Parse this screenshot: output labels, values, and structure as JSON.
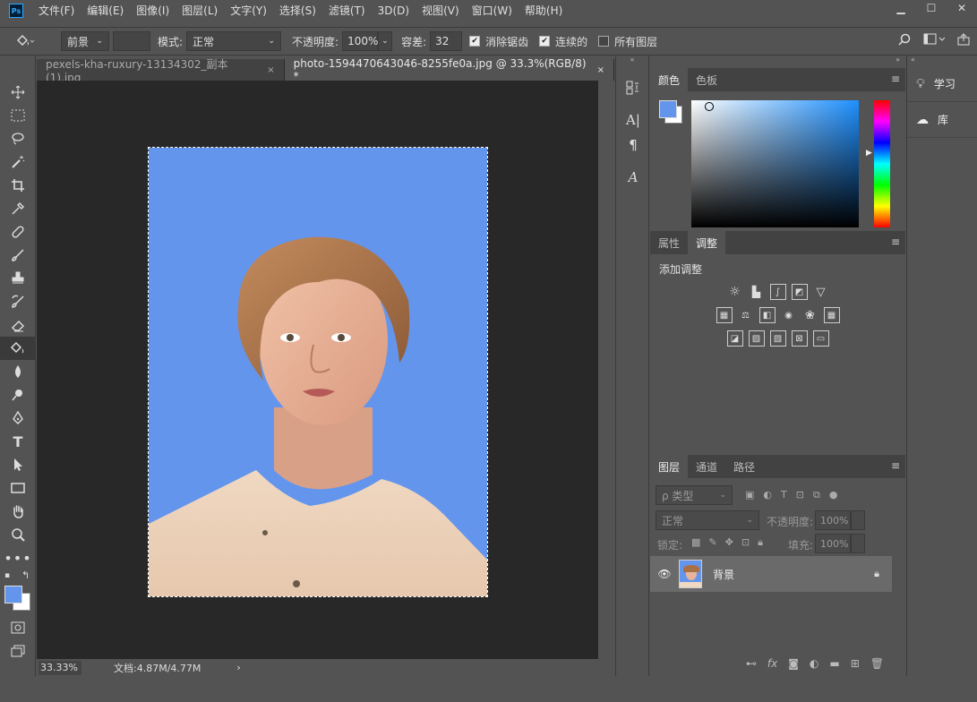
{
  "menu": {
    "items": [
      "文件(F)",
      "编辑(E)",
      "图像(I)",
      "图层(L)",
      "文字(Y)",
      "选择(S)",
      "滤镜(T)",
      "3D(D)",
      "视图(V)",
      "窗口(W)",
      "帮助(H)"
    ]
  },
  "window": {
    "minimize": "▁",
    "maximize": "☐",
    "close": "✕"
  },
  "options": {
    "fill_source": "前景",
    "mode_label": "模式:",
    "mode_value": "正常",
    "opacity_label": "不透明度:",
    "opacity_value": "100%",
    "tolerance_label": "容差:",
    "tolerance_value": "32",
    "antialias_label": "消除锯齿",
    "contiguous_label": "连续的",
    "all_layers_label": "所有图层"
  },
  "tabs": [
    {
      "label": "pexels-kha-ruxury-13134302_副本(1).jpg",
      "close": "×"
    },
    {
      "label": "photo-1594470643046-8255fe0a.jpg @ 33.3%(RGB/8) *",
      "close": "×"
    }
  ],
  "status": {
    "zoom": "33.33%",
    "doc": "文档:4.87M/4.77M",
    "arrow": "›"
  },
  "color_panel": {
    "tab_color": "颜色",
    "tab_swatches": "色板",
    "fg": "#6495ed",
    "bg": "#ffffff"
  },
  "adjust_panel": {
    "tab_props": "属性",
    "tab_adjust": "调整",
    "add_label": "添加调整"
  },
  "layers_panel": {
    "tab_layers": "图层",
    "tab_channels": "通道",
    "tab_paths": "路径",
    "kind": "ρ 类型",
    "blend": "正常",
    "opacity_label": "不透明度:",
    "opacity_value": "100%",
    "lock_label": "锁定:",
    "fill_label": "填充:",
    "fill_value": "100%",
    "layer_name": "背景"
  },
  "right_panel": {
    "learn": "学习",
    "library": "库"
  },
  "colors": {
    "canvas_bg": "#6495ed"
  }
}
